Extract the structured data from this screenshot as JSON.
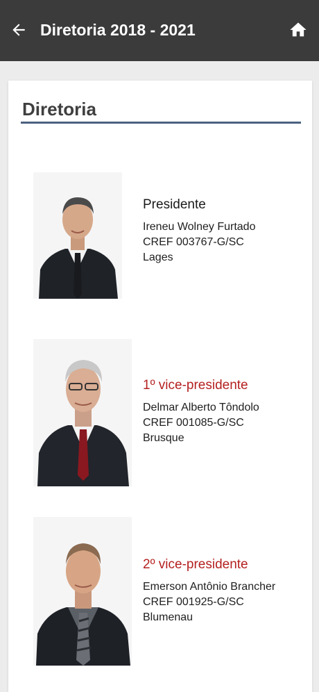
{
  "app_bar": {
    "title": "Diretoria 2018 - 2021",
    "back_icon": "arrow-left-icon",
    "home_icon": "home-icon",
    "background": "#3b3b3b"
  },
  "section": {
    "title": "Diretoria",
    "rule_color": "#4a6181"
  },
  "members": [
    {
      "role": "Presidente",
      "name": "Ireneu Wolney Furtado",
      "registration": "CREF 003767-G/SC",
      "city": "Lages",
      "role_color": "#1a1a1a"
    },
    {
      "role": "1º vice-presidente",
      "name": "Delmar Alberto Tôndolo",
      "registration": "CREF 001085-G/SC",
      "city": "Brusque",
      "role_color": "#b52020"
    },
    {
      "role": "2º vice-presidente",
      "name": "Emerson Antônio Brancher",
      "registration": "CREF 001925-G/SC",
      "city": "Blumenau",
      "role_color": "#b52020"
    }
  ]
}
